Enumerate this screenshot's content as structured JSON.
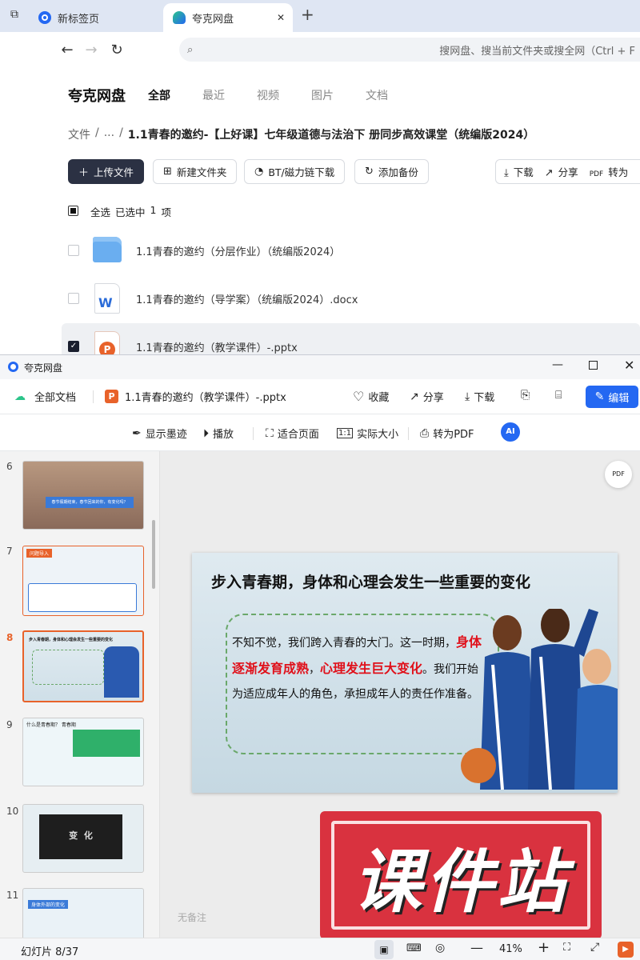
{
  "browser": {
    "tabs": [
      {
        "label": "新标签页",
        "active": false
      },
      {
        "label": "夸克网盘",
        "active": true
      }
    ],
    "new_tab": "+",
    "close": "✕",
    "address_placeholder": "搜网盘、搜当前文件夹或搜全网（Ctrl + F"
  },
  "drive": {
    "brand": "夸克网盘",
    "nav": [
      "全部",
      "最近",
      "视频",
      "图片",
      "文档"
    ],
    "breadcrumb": {
      "root": "文件",
      "sep": "/",
      "ellipsis": "...",
      "current": "1.1青春的邀约-【上好课】七年级道德与法治下 册同步高效课堂（统编版2024）"
    },
    "actions": {
      "upload": "上传文件",
      "new_folder": "新建文件夹",
      "bt": "BT/磁力链下载",
      "backup": "添加备份",
      "download": "下载",
      "share": "分享",
      "convert": "转为"
    },
    "select": {
      "all": "全选",
      "selected": "已选中",
      "count": "1",
      "unit": "项"
    },
    "files": [
      {
        "name": "1.1青春的邀约（分层作业）（统编版2024）",
        "type": "folder",
        "checked": false
      },
      {
        "name": "1.1青春的邀约（导学案）（统编版2024）.docx",
        "type": "docx",
        "checked": false
      },
      {
        "name": "1.1青春的邀约（教学课件）-.pptx",
        "type": "pptx",
        "checked": true
      }
    ]
  },
  "viewer": {
    "window_title": "夸克网盘",
    "all_docs": "全部文档",
    "file_name": "1.1青春的邀约（教学课件）-.pptx",
    "actions": {
      "favorite": "收藏",
      "share": "分享",
      "download": "下载",
      "edit": "编辑"
    },
    "toolbar": {
      "ink": "显示墨迹",
      "play": "播放",
      "fit_page": "适合页面",
      "actual": "实际大小",
      "to_pdf": "转为PDF",
      "ai": "AI"
    },
    "thumbnails": [
      {
        "num": "6",
        "caption": "春节假期结束，春节回来的你，有变化吗？"
      },
      {
        "num": "7",
        "caption": "问题导入"
      },
      {
        "num": "8",
        "caption": "步入青春期，身体和心理会发生一些重要的变化"
      },
      {
        "num": "9",
        "caption": "什么是青春期？  青春期"
      },
      {
        "num": "10",
        "caption": "变  化"
      },
      {
        "num": "11",
        "caption": "身体外部的变化"
      }
    ],
    "selected_thumb": "8",
    "slide": {
      "title": "步入青春期，身体和心理会发生一些重要的变化",
      "p1": "不知不觉，我们跨入青春的大门。这一时期，",
      "hl1": "身体逐渐发育成熟",
      "sep": "，",
      "hl2": "心理发生巨大变化",
      "p2": "。我们开始为适应成年人的角色，承担成年人的责任作准备。"
    },
    "watermark": "课件站",
    "notes": "无备注",
    "status": {
      "slide_label": "幻灯片 8/37",
      "zoom": "41%"
    }
  },
  "colors": {
    "accent": "#2468f2",
    "dark_button": "#2b3143",
    "pptx": "#e8622a",
    "stamp": "#d9323f"
  }
}
